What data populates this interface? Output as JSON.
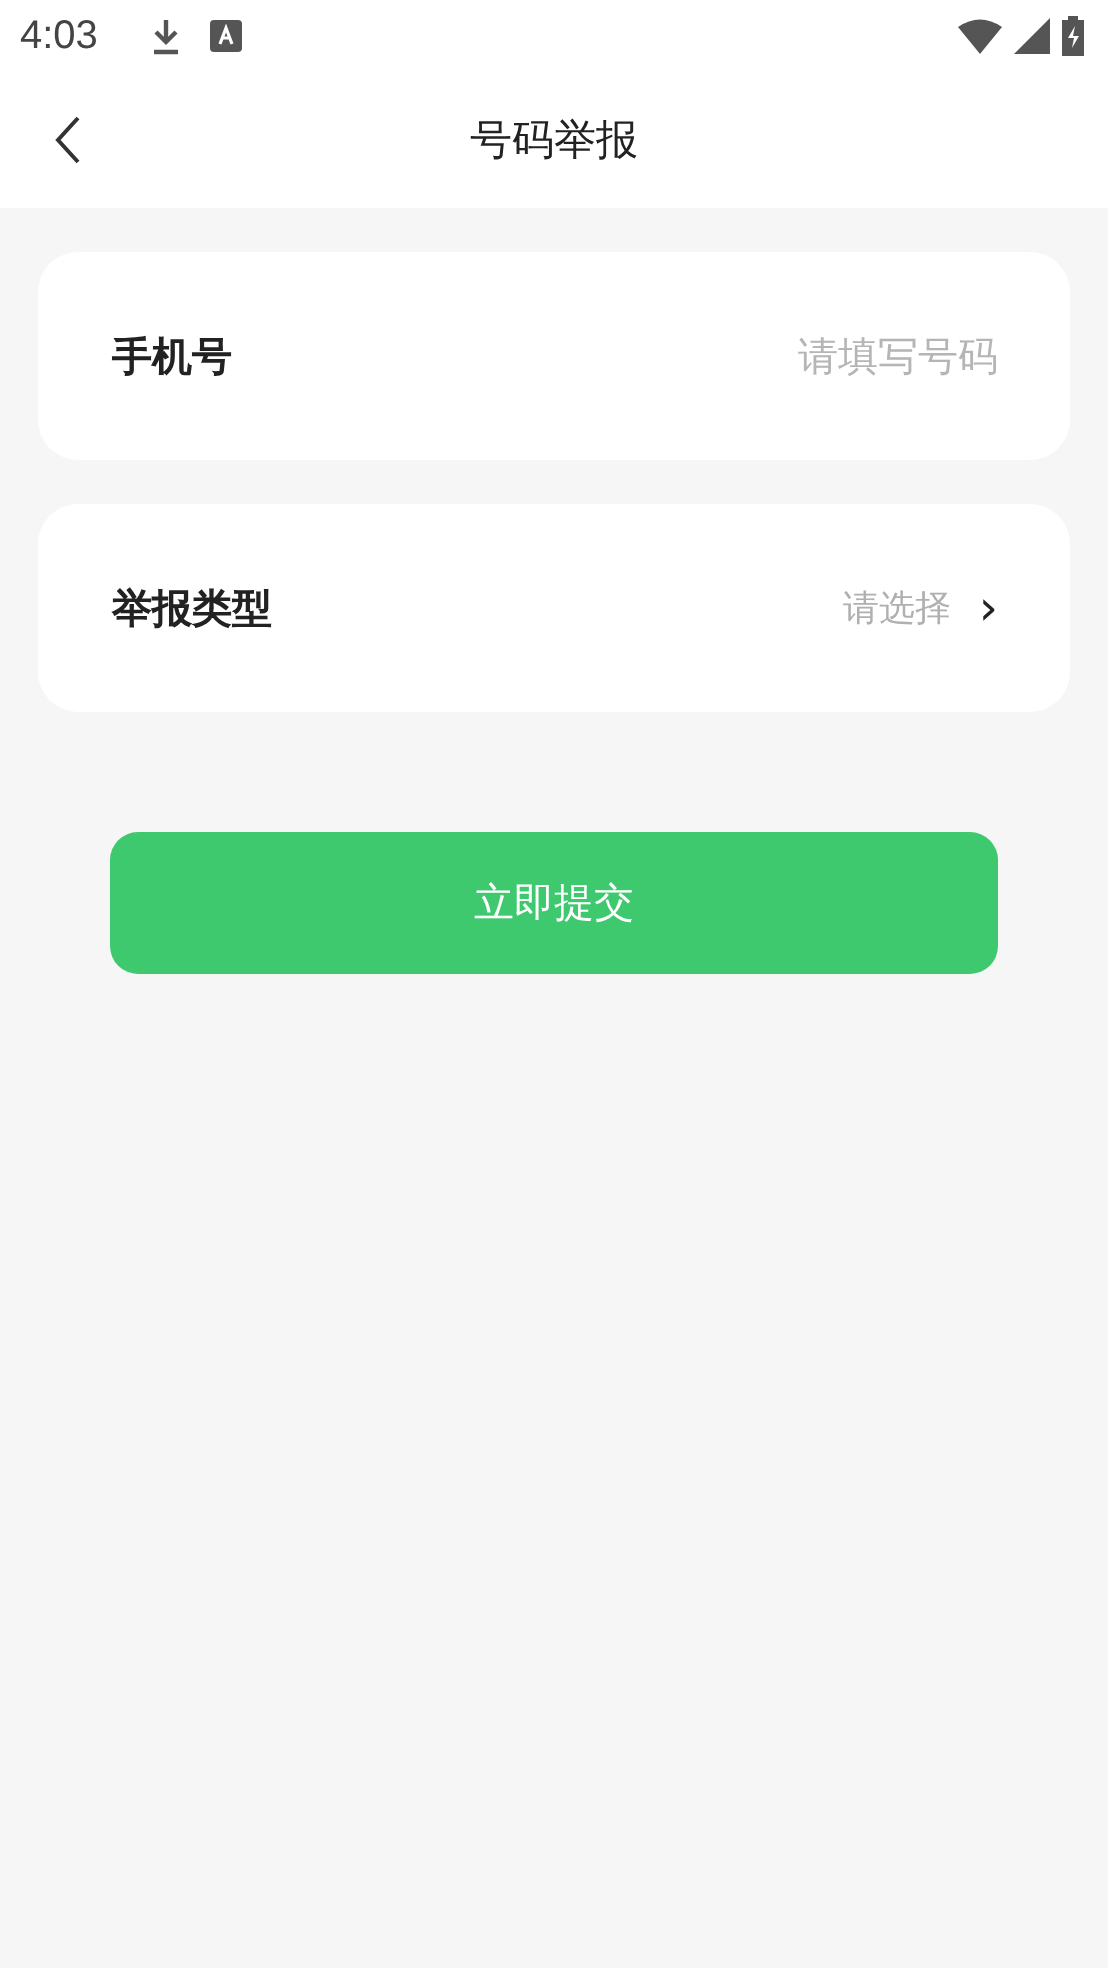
{
  "status_bar": {
    "time": "4:03"
  },
  "header": {
    "title": "号码举报"
  },
  "fields": [
    {
      "kind": "input",
      "label": "手机号",
      "placeholder": "请填写号码"
    },
    {
      "kind": "select",
      "label": "举报类型",
      "placeholder": "请选择",
      "chevron": "›"
    }
  ],
  "submit": {
    "label": "立即提交"
  }
}
